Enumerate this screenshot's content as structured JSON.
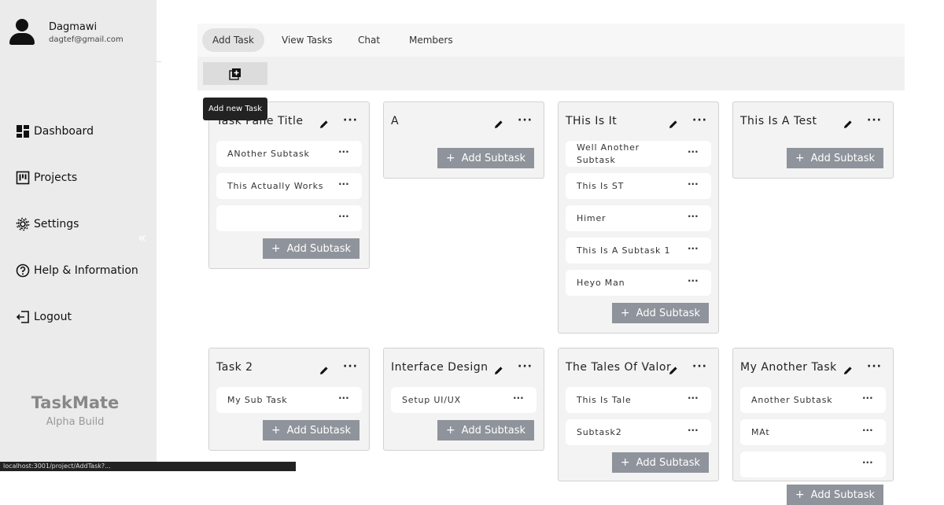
{
  "user": {
    "name": "Dagmawi",
    "email": "dagtef@gmail.com"
  },
  "nav": [
    {
      "label": "Dashboard",
      "icon": "dashboard-icon"
    },
    {
      "label": "Projects",
      "icon": "projects-icon"
    },
    {
      "label": "Settings",
      "icon": "gear-icon"
    },
    {
      "label": "Help & Information",
      "icon": "help-icon"
    },
    {
      "label": "Logout",
      "icon": "logout-icon"
    }
  ],
  "collapse_glyph": "«",
  "brand": {
    "name": "TaskMate",
    "subtitle": "Alpha Build"
  },
  "statusbar": "localhost:3001/project/AddTask?...",
  "tabs": [
    "Add Task",
    "View Tasks",
    "Chat",
    "Members"
  ],
  "tooltip": "Add new Task",
  "add_subtask_label": "Add Subtask",
  "more_glyph": "···",
  "sub_more_glyph": "···",
  "panes": [
    {
      "title": "Task Pane Title",
      "subtasks": [
        "ANother Subtask",
        "This Actually Works",
        ""
      ]
    },
    {
      "title": "A",
      "subtasks": []
    },
    {
      "title": "THis Is It",
      "subtasks": [
        "Well Another Subtask",
        "This Is ST",
        "Himer",
        "This Is A Subtask 1",
        "Heyo Man"
      ]
    },
    {
      "title": "This Is A Test",
      "subtasks": []
    },
    {
      "title": "Task 2",
      "subtasks": [
        "My Sub Task"
      ]
    },
    {
      "title": "Interface Design",
      "subtasks": [
        "Setup UI/UX"
      ]
    },
    {
      "title": "The Tales Of Valor",
      "subtasks": [
        "This Is Tale",
        "Subtask2"
      ]
    },
    {
      "title": "My Another Task",
      "subtasks": [
        "Another Subtask",
        "MAt",
        ""
      ]
    }
  ]
}
